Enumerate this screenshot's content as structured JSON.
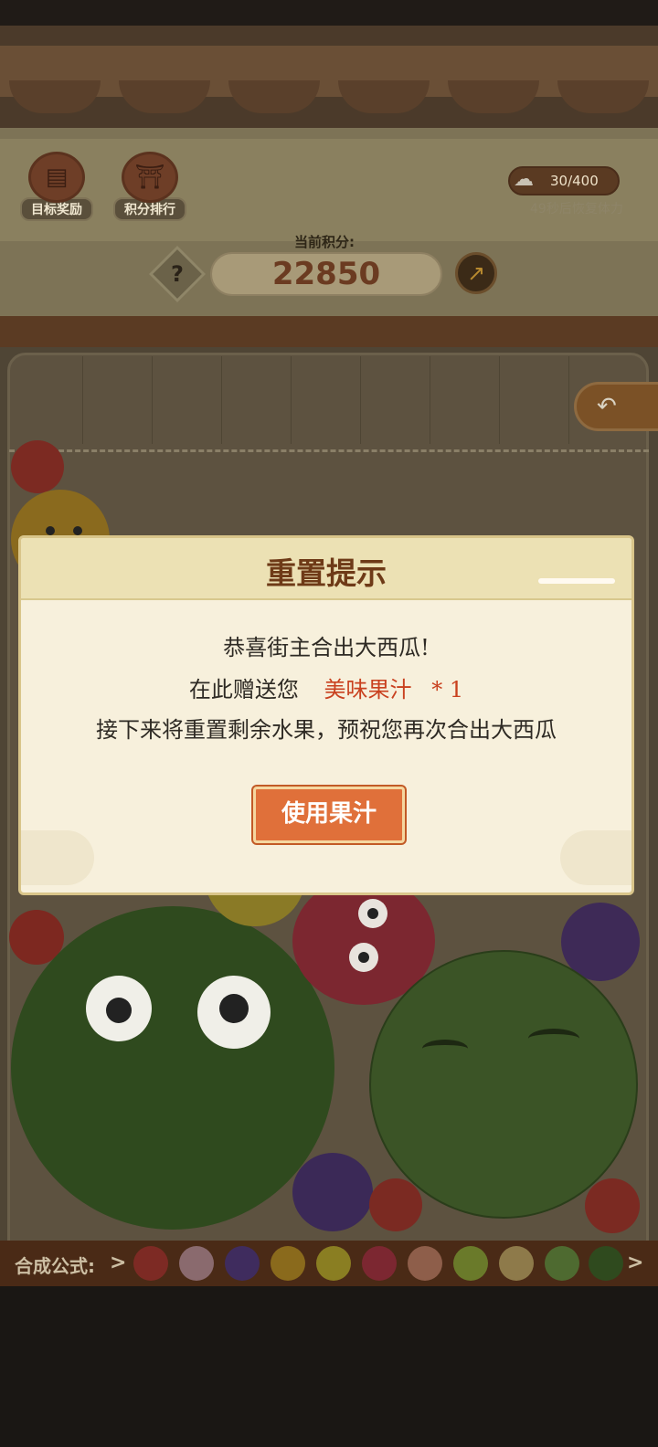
{
  "header": {
    "buttons": [
      {
        "label": "目标奖励",
        "icon": "treasure-chest-icon"
      },
      {
        "label": "积分排行",
        "icon": "leaderboard-gate-icon"
      }
    ],
    "stamina": {
      "value": "30/400",
      "recover_text": "49秒后恢复体力",
      "icon": "cloud-plus-icon"
    },
    "score_label": "当前积分:",
    "score_value": "22850",
    "help_icon": "?",
    "share_icon": "share-arrow-icon"
  },
  "board": {
    "back_icon": "undo-icon"
  },
  "dialog": {
    "title": "重置提示",
    "line1": "恭喜街主合出大西瓜!",
    "line2_prefix": "在此赠送您",
    "line2_item": "美味果汁",
    "line2_count": "* 1",
    "line3": "接下来将重置剩余水果，预祝您再次合出大西瓜",
    "button_label": "使用果汁"
  },
  "formula": {
    "label": "合成公式:",
    "fruits": [
      "cherry",
      "strawberry",
      "grape",
      "orange",
      "lemon",
      "apple",
      "peach",
      "kiwi",
      "pear",
      "melon",
      "watermelon"
    ]
  },
  "colors": {
    "accent": "#e0703a",
    "title": "#6e3a17",
    "highlight": "#c9411f"
  }
}
